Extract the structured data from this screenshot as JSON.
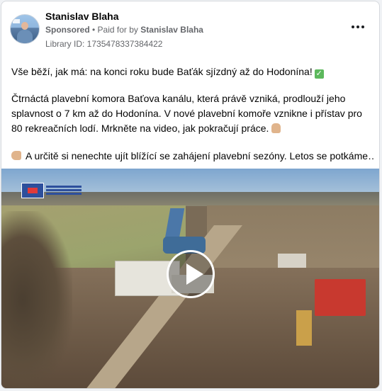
{
  "post": {
    "author": "Stanislav Blaha",
    "sponsored_label": "Sponsored",
    "paid_for_prefix": "• Paid for by",
    "paid_by": "Stanislav Blaha",
    "library_id": "Library ID: 1735478337384422",
    "more_icon": "more-dots-icon",
    "text_line1": "Vše běží, jak má: na konci roku bude Baťák sjízdný až do Hodonína!",
    "text_para2": "Čtrnáctá plavební komora Baťova kanálu, která právě vzniká, prodlouží jeho splavnost o 7 km až do Hodonína. V nové plavební komoře vznikne i přístav pro 80 rekreačních lodí. Mrkněte na video, jak pokračují práce.",
    "text_para3": "A určitě si nenechte ujít blížící se zahájení plavební sezóny. Letos se potkáme…",
    "emoji_check": "✓",
    "video_play_icon": "play-icon"
  }
}
